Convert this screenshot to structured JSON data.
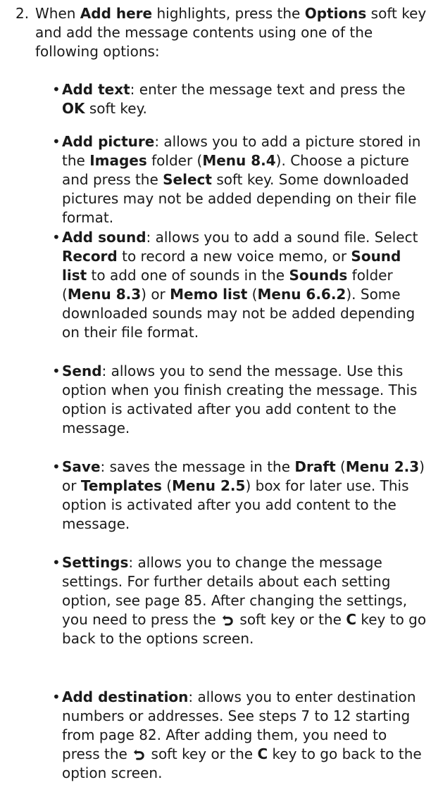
{
  "step": {
    "number": "2.",
    "text": [
      "When ",
      "Add here",
      " highlights, press the ",
      "Options",
      " soft key and add the message contents using one of the following options:"
    ]
  },
  "bullet_char": "•",
  "options": [
    {
      "name": "Add text",
      "segments": [
        ": enter the message text and press the ",
        "OK",
        " soft key."
      ]
    },
    {
      "name": "Add picture",
      "segments": [
        ": allows you to add a picture stored in the ",
        "Images",
        " folder (",
        "Menu 8.4",
        "). Choose a picture and press the ",
        "Select",
        " soft key. Some downloaded pictures may not be added depending on their file format."
      ]
    },
    {
      "name": "Add sound",
      "segments": [
        ": allows you to add a sound file. Select ",
        "Record",
        " to record a new voice memo, or ",
        "Sound list",
        " to add one of sounds in the ",
        "Sounds",
        " folder (",
        "Menu 8.3",
        ") or ",
        "Memo list",
        " (",
        "Menu 6.6.2",
        "). Some downloaded sounds may not be added depending on their file format."
      ]
    },
    {
      "name": "Send",
      "segments": [
        ": allows you to send the message. Use this option when you finish creating the message. This option is activated after you add content to the message."
      ]
    },
    {
      "name": "Save",
      "segments": [
        ": saves the message in the ",
        "Draft",
        " (",
        "Menu 2.3",
        ") or ",
        "Templates",
        " (",
        "Menu 2.5",
        ") box for later use. This option is activated after you add content to the message."
      ]
    },
    {
      "name": "Settings",
      "segments": [
        ": allows you to change the message settings. For further details about each setting option, see page 85. After changing the settings, you need to press the ",
        " soft key or the ",
        "C",
        " key to go back to the options screen."
      ]
    },
    {
      "name": "Add destination",
      "segments": [
        ": allows you to enter destination numbers or addresses. See steps 7 to 12 starting from page 82. After adding them, you need to press the ",
        " soft key or the ",
        "C",
        " key to go back to the option screen."
      ]
    }
  ]
}
